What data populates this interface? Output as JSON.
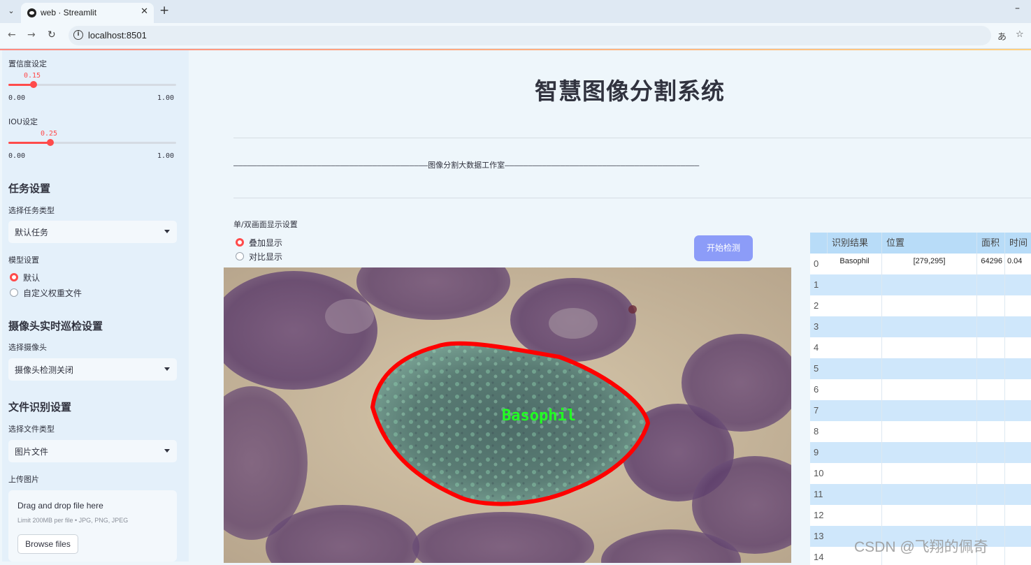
{
  "browser": {
    "tab_title": "web · Streamlit",
    "url": "localhost:8501"
  },
  "sidebar": {
    "confidence": {
      "label": "置信度设定",
      "value": "0.15",
      "min": "0.00",
      "max": "1.00",
      "fraction": 0.15
    },
    "iou": {
      "label": "IOU设定",
      "value": "0.25",
      "min": "0.00",
      "max": "1.00",
      "fraction": 0.25
    },
    "task_heading": "任务设置",
    "task_type_label": "选择任务类型",
    "task_type_value": "默认任务",
    "model_label": "模型设置",
    "model_options": [
      "默认",
      "自定义权重文件"
    ],
    "camera_heading": "摄像头实时巡检设置",
    "camera_label": "选择摄像头",
    "camera_value": "摄像头检测关闭",
    "file_heading": "文件识别设置",
    "file_type_label": "选择文件类型",
    "file_type_value": "图片文件",
    "upload_label": "上传图片",
    "upload_title": "Drag and drop file here",
    "upload_limit": "Limit 200MB per file • JPG, PNG, JPEG",
    "browse_button": "Browse files"
  },
  "main": {
    "title": "智慧图像分割系统",
    "studio_line": "——————————————————————————————————————————图像分割大数据工作室——————————————————————————————————————————",
    "display_label": "单/双画面显示设置",
    "display_options": [
      "叠加显示",
      "对比显示"
    ],
    "start_button": "开始检测",
    "detection_label": "Basophil"
  },
  "table": {
    "columns": [
      "识别结果",
      "位置",
      "面积",
      "时间"
    ],
    "rows": [
      {
        "index": "0",
        "result": "Basophil",
        "position": "[279,295]",
        "area": "64296",
        "time": "0.04"
      },
      {
        "index": "1"
      },
      {
        "index": "2"
      },
      {
        "index": "3"
      },
      {
        "index": "4"
      },
      {
        "index": "5"
      },
      {
        "index": "6"
      },
      {
        "index": "7"
      },
      {
        "index": "8"
      },
      {
        "index": "9"
      },
      {
        "index": "10"
      },
      {
        "index": "11"
      },
      {
        "index": "12"
      },
      {
        "index": "13"
      },
      {
        "index": "14"
      }
    ]
  },
  "watermark": "CSDN @飞翔的佩奇",
  "colors": {
    "accent": "#ff4b4b",
    "button": "#8c9cf8",
    "row_alt": "#cfe7fb",
    "header": "#b8dcf8"
  }
}
